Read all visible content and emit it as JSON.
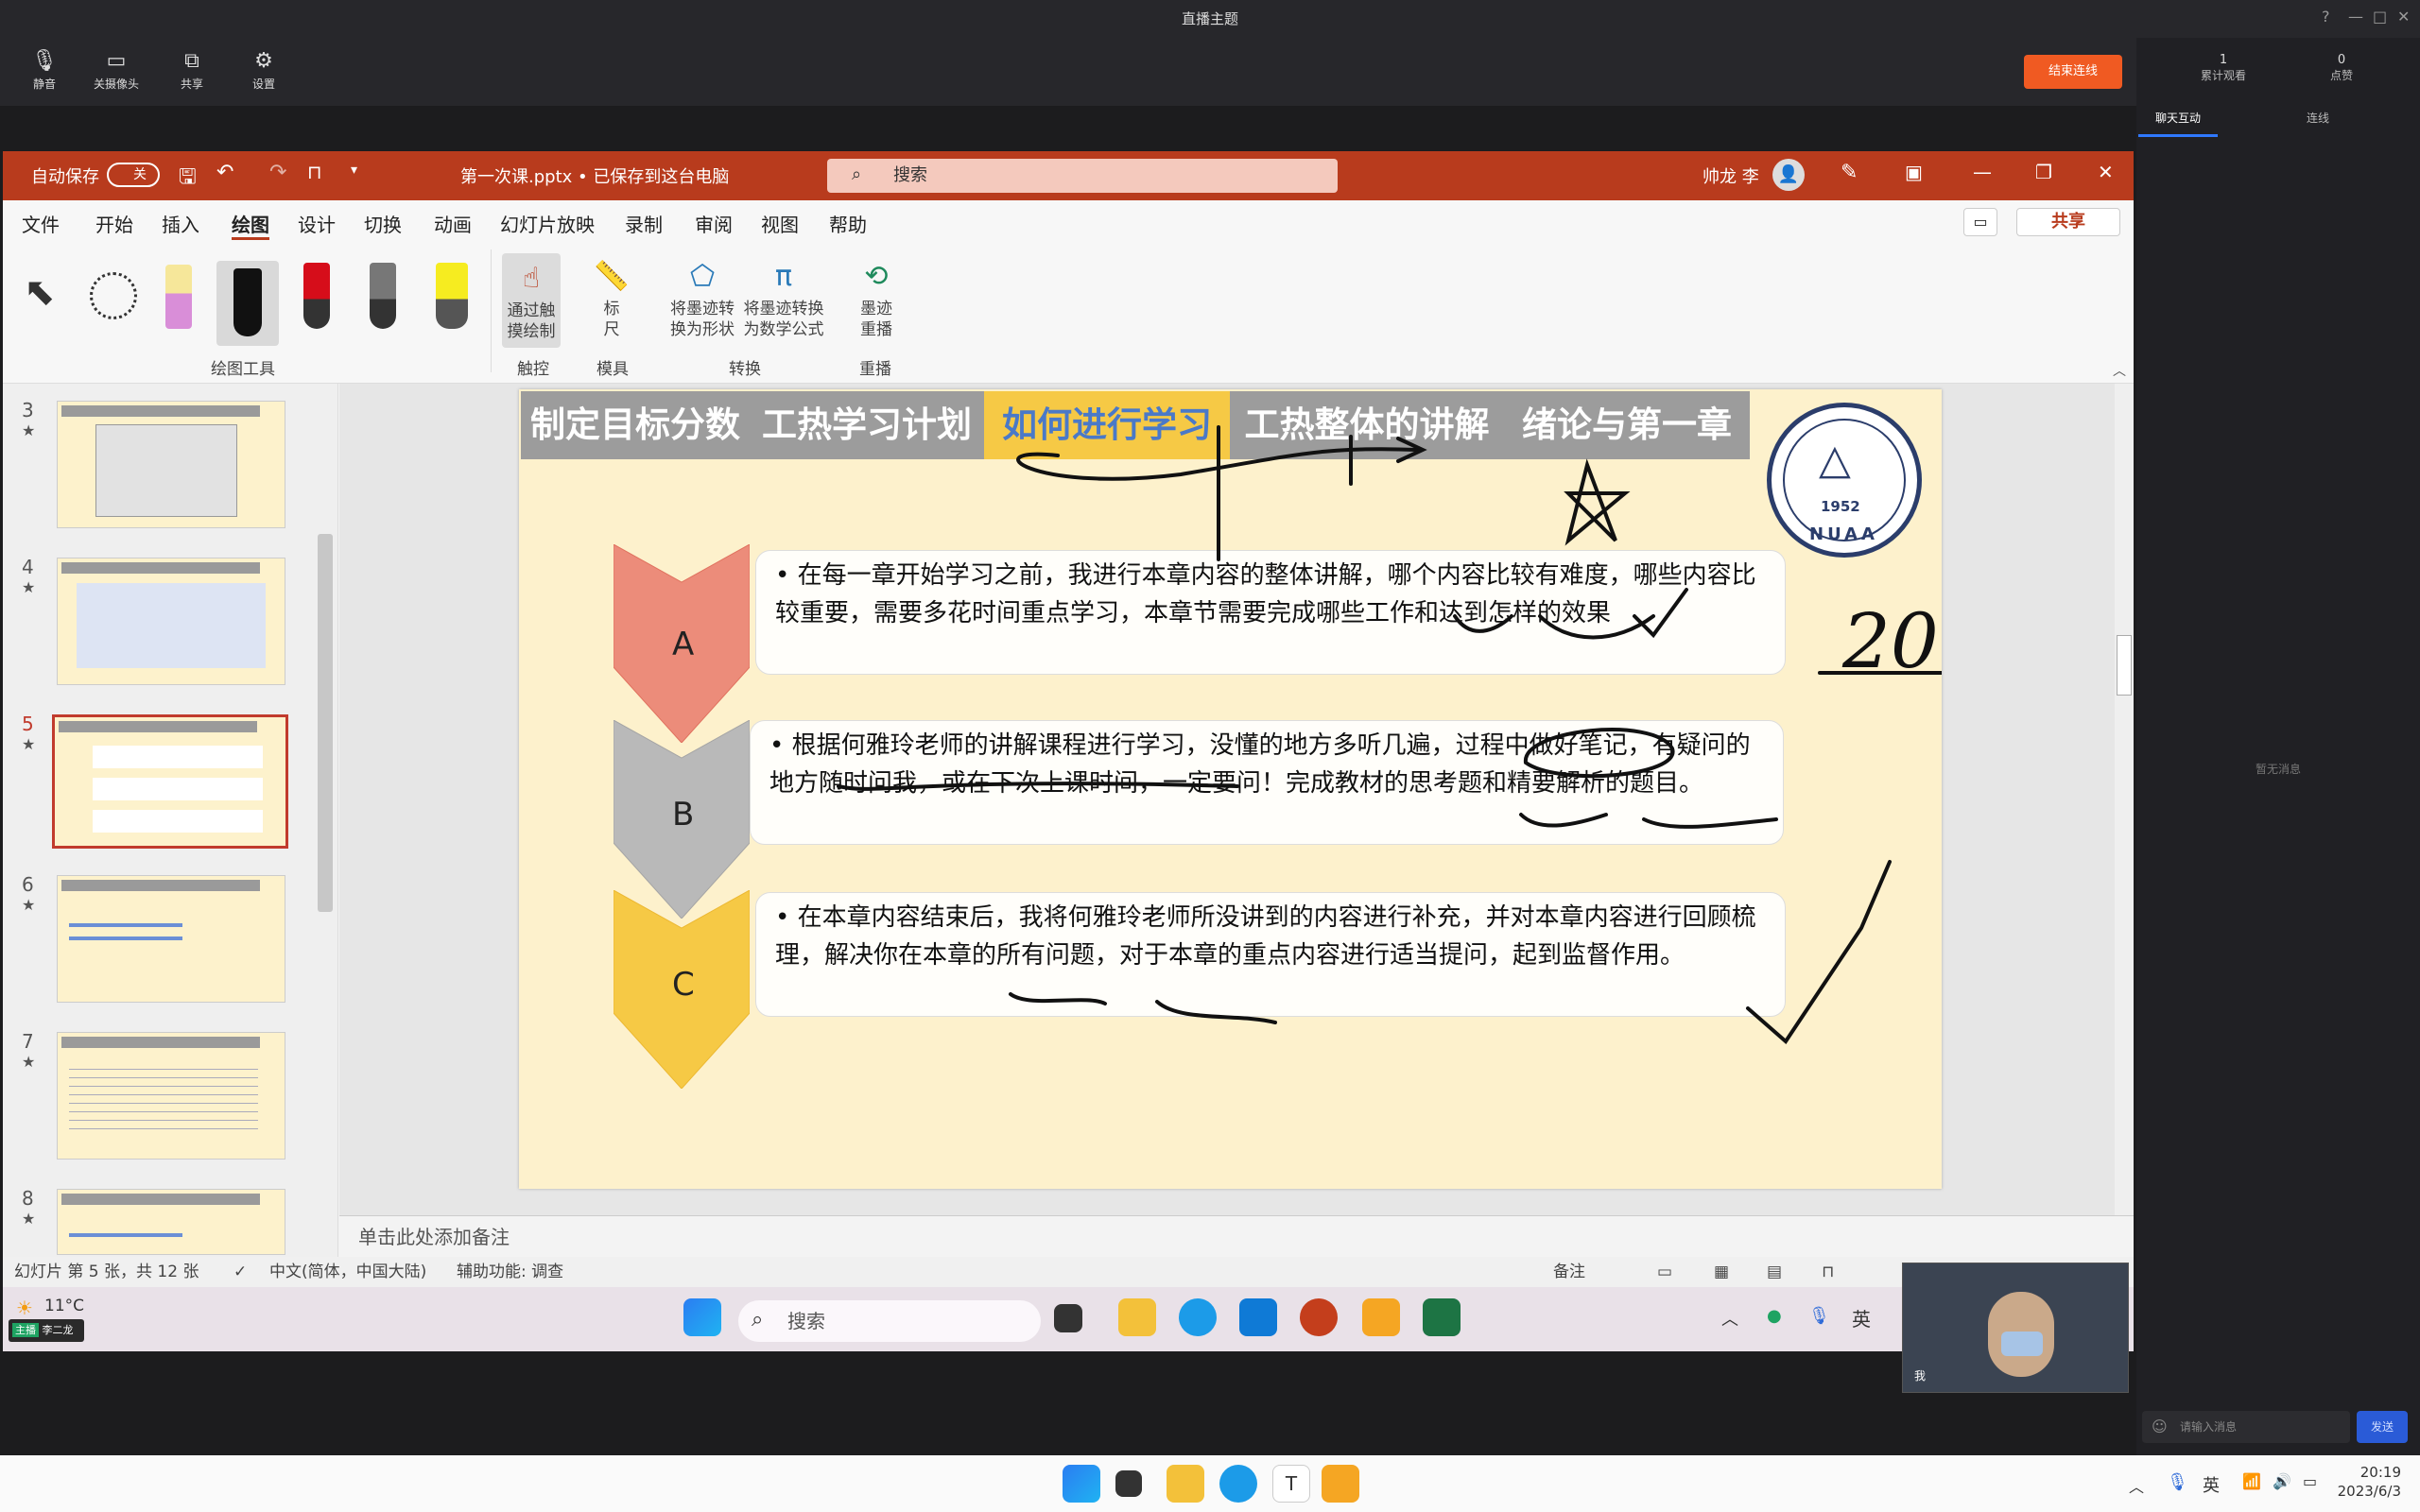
{
  "live": {
    "window_title": "直播主题",
    "toolbar": [
      {
        "icon": "microphone-icon",
        "label": "静音"
      },
      {
        "icon": "camera-off-icon",
        "label": "关摄像头"
      },
      {
        "icon": "share-screen-icon",
        "label": "共享"
      },
      {
        "icon": "gear-icon",
        "label": "设置"
      }
    ],
    "end_button": "结束连线",
    "stats": [
      {
        "value": "1",
        "label": "累计观看"
      },
      {
        "value": "0",
        "label": "点赞"
      }
    ],
    "tabs": [
      "聊天互动",
      "连线"
    ],
    "no_message": "暂无消息",
    "chat_placeholder": "请输入消息",
    "send_label": "发送"
  },
  "ppt": {
    "autosave_label": "自动保存",
    "autosave_state": "关",
    "file_title": "第一次课.pptx • 已保存到这台电脑",
    "search_placeholder": "搜索",
    "user_name": "帅龙 李",
    "menu": [
      "文件",
      "开始",
      "插入",
      "绘图",
      "设计",
      "切换",
      "动画",
      "幻灯片放映",
      "录制",
      "审阅",
      "视图",
      "帮助"
    ],
    "active_menu": "绘图",
    "share_label": "共享",
    "ribbon": {
      "groups": [
        "绘图工具",
        "触控",
        "模具",
        "转换",
        "重播"
      ],
      "touch_btn": [
        "通过触",
        "摸绘制"
      ],
      "ruler_btn": [
        "标",
        "尺"
      ],
      "ink_shape": [
        "将墨迹转",
        "换为形状"
      ],
      "ink_math": [
        "将墨迹转换",
        "为数学公式"
      ],
      "replay": [
        "墨迹",
        "重播"
      ]
    },
    "slide_numbers": [
      "3",
      "4",
      "5",
      "6",
      "7",
      "8"
    ],
    "notes_placeholder": "单击此处添加备注",
    "status": {
      "slide_count": "幻灯片 第 5 张，共 12 张",
      "language": "中文(简体，中国大陆)",
      "accessibility": "辅助功能: 调查",
      "notes": "备注"
    }
  },
  "slide": {
    "tabs": [
      "制定目标分数",
      "工热学习计划",
      "如何进行学习",
      "工热整体的讲解",
      "绪论与第一章"
    ],
    "active_tab": "如何进行学习",
    "logo_year": "1952",
    "logo_text": "NUAA",
    "items": [
      {
        "letter": "A",
        "color": "#ec8c7a",
        "text": "• 在每一章开始学习之前，我进行本章内容的整体讲解，哪个内容比较有难度，哪些内容比较重要，需要多花时间重点学习，本章节需要完成哪些工作和达到怎样的效果"
      },
      {
        "letter": "B",
        "color": "#b9b9b9",
        "text": "• 根据何雅玲老师的讲解课程进行学习，没懂的地方多听几遍，过程中做好笔记，有疑问的地方随时问我，或在下次上课时间，一定要问！完成教材的思考题和精要解析的题目。"
      },
      {
        "letter": "C",
        "color": "#f6c945",
        "text": "• 在本章内容结束后，我将何雅玲老师所没讲到的内容进行补充，并对本章内容进行回顾梳理，解决你在本章的所有问题，对于本章的重点内容进行适当提问，起到监督作用。"
      }
    ],
    "handwritten_number": "20"
  },
  "taskbar": {
    "weather": "11°C",
    "search": "搜索",
    "lang": "英",
    "cam_label": "我",
    "streamer": "李二龙",
    "streamer_tag": "主播"
  },
  "host": {
    "time": "20:19",
    "date": "2023/6/3",
    "lang": "英"
  }
}
